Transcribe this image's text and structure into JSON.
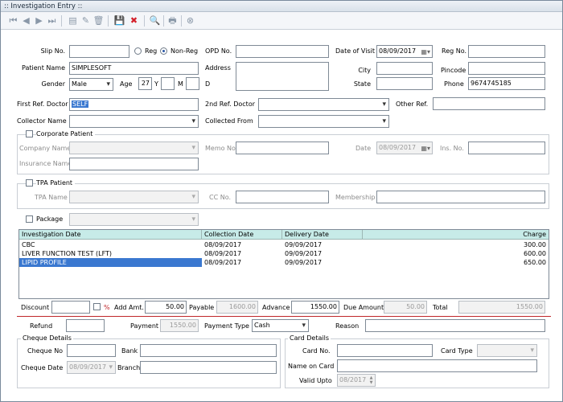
{
  "window": {
    "title": ":: Investigation Entry ::"
  },
  "toolbar": {
    "icons": [
      "first-icon",
      "prev-icon",
      "next-icon",
      "last-icon",
      "new-icon",
      "edit-icon",
      "delete-bin-icon",
      "save-icon",
      "cancel-icon",
      "search-icon",
      "print-icon",
      "close-icon"
    ]
  },
  "form": {
    "slip_no": {
      "label": "Slip No.",
      "value": ""
    },
    "reg_label": "Reg",
    "nonreg_label": "Non-Reg",
    "opd_no": {
      "label": "OPD No.",
      "value": ""
    },
    "date_of_visit": {
      "label": "Date of Visit",
      "value": "08/09/2017"
    },
    "reg_no": {
      "label": "Reg No.",
      "value": ""
    },
    "patient_name": {
      "label": "Patient Name",
      "value": "SIMPLESOFT"
    },
    "address": {
      "label": "Address",
      "value": ""
    },
    "city": {
      "label": "City",
      "value": ""
    },
    "pincode": {
      "label": "Pincode",
      "value": ""
    },
    "gender": {
      "label": "Gender",
      "value": "Male"
    },
    "age": {
      "label": "Age",
      "years": "27",
      "y_label": "Y",
      "months": "",
      "m_label": "M",
      "days": "",
      "d_label": "D"
    },
    "state": {
      "label": "State",
      "value": ""
    },
    "phone": {
      "label": "Phone",
      "value": "9674745185"
    },
    "first_ref_doctor": {
      "label": "First Ref. Doctor",
      "value": "SELF"
    },
    "second_ref_doctor": {
      "label": "2nd Ref. Doctor",
      "value": ""
    },
    "other_ref": {
      "label": "Other Ref.",
      "value": ""
    },
    "collector_name": {
      "label": "Collector Name",
      "value": ""
    },
    "collected_from": {
      "label": "Collected From",
      "value": ""
    }
  },
  "corporate": {
    "label": "Corporate Patient",
    "company_name": {
      "label": "Company Name",
      "value": ""
    },
    "memo_no": {
      "label": "Memo No.",
      "value": ""
    },
    "date": {
      "label": "Date",
      "value": "08/09/2017"
    },
    "ins_no": {
      "label": "Ins. No.",
      "value": ""
    },
    "insurance_name": {
      "label": "Insurance Name",
      "value": ""
    }
  },
  "tpa": {
    "label": "TPA Patient",
    "tpa_name": {
      "label": "TPA Name",
      "value": ""
    },
    "cc_no": {
      "label": "CC No.",
      "value": ""
    },
    "membership": {
      "label": "Membership",
      "value": ""
    }
  },
  "package": {
    "label": "Package",
    "value": ""
  },
  "investigations": {
    "columns": [
      "Investigation Date",
      "Collection Date",
      "Delivery Date",
      "Charge"
    ],
    "rows": [
      {
        "name": "CBC",
        "collection": "08/09/2017",
        "delivery": "09/09/2017",
        "charge": "300.00"
      },
      {
        "name": "LIVER FUNCTION TEST (LFT)",
        "collection": "08/09/2017",
        "delivery": "09/09/2017",
        "charge": "600.00"
      },
      {
        "name": "LIPID PROFILE",
        "collection": "08/09/2017",
        "delivery": "09/09/2017",
        "charge": "650.00"
      }
    ]
  },
  "totals": {
    "discount": {
      "label": "Discount",
      "value": ""
    },
    "percent": "%",
    "add_amt": {
      "label": "Add Amt.",
      "value": "50.00"
    },
    "payable": {
      "label": "Payable",
      "value": "1600.00"
    },
    "advance": {
      "label": "Advance",
      "value": "1550.00"
    },
    "due_amount": {
      "label": "Due Amount",
      "value": "50.00"
    },
    "total": {
      "label": "Total",
      "value": "1550.00"
    }
  },
  "payment": {
    "refund": {
      "label": "Refund",
      "value": ""
    },
    "payment": {
      "label": "Payment",
      "value": "1550.00"
    },
    "payment_type": {
      "label": "Payment Type",
      "value": "Cash"
    },
    "reason": {
      "label": "Reason",
      "value": ""
    }
  },
  "cheque": {
    "title": "Cheque Details",
    "cheque_no": {
      "label": "Cheque No",
      "value": ""
    },
    "bank": {
      "label": "Bank",
      "value": ""
    },
    "cheque_date": {
      "label": "Cheque Date",
      "value": "08/09/2017"
    },
    "branch": {
      "label": "Branch",
      "value": ""
    }
  },
  "card": {
    "title": "Card Details",
    "card_no": {
      "label": "Card No.",
      "value": ""
    },
    "card_type": {
      "label": "Card Type",
      "value": ""
    },
    "name_on_card": {
      "label": "Name on Card",
      "value": ""
    },
    "valid_upto": {
      "label": "Valid Upto",
      "value": "08/2017"
    }
  },
  "colors": {
    "accent": "#2a56a6",
    "grid_header": "#c7ebe8",
    "selection": "#3a78d0",
    "divider": "#c0262a"
  }
}
